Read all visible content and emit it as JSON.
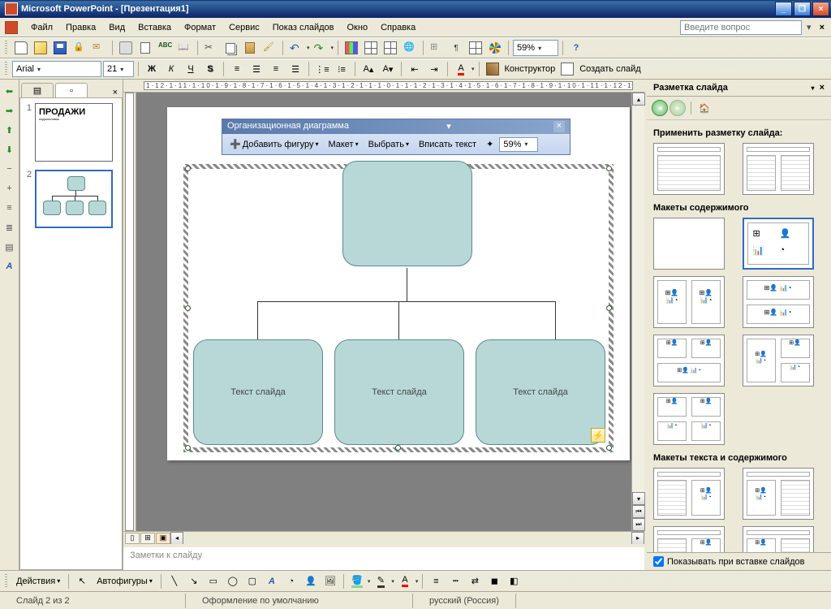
{
  "window": {
    "title": "Microsoft PowerPoint - [Презентация1]"
  },
  "menu": {
    "file": "Файл",
    "edit": "Правка",
    "view": "Вид",
    "insert": "Вставка",
    "format": "Формат",
    "service": "Сервис",
    "slideshow": "Показ слайдов",
    "window": "Окно",
    "help": "Справка",
    "question_placeholder": "Введите вопрос"
  },
  "toolbar1": {
    "zoom": "59%",
    "percent_org": "59%"
  },
  "toolbar2": {
    "font": "Arial",
    "size": "21",
    "constructor": "Конструктор",
    "new_slide": "Создать слайд"
  },
  "org_toolbar": {
    "title": "Организационная диаграмма",
    "add_shape": "Добавить фигуру",
    "layout": "Макет",
    "select": "Выбрать",
    "fit_text": "Вписать текст",
    "zoom": "59%"
  },
  "slide_text": {
    "box1": "Текст слайда",
    "box2": "Текст слайда",
    "box3": "Текст слайда"
  },
  "notes": {
    "placeholder": "Заметки к слайду"
  },
  "task_pane": {
    "title": "Разметка слайда",
    "apply_label": "Применить разметку слайда:",
    "section_content": "Макеты содержимого",
    "section_text_content": "Макеты текста и содержимого",
    "footer_checkbox": "Показывать при вставке слайдов"
  },
  "drawing": {
    "actions": "Действия",
    "autoshapes": "Автофигуры"
  },
  "status": {
    "slide_pos": "Слайд 2 из 2",
    "template": "Оформление по умолчанию",
    "language": "русский (Россия)"
  },
  "slides": {
    "num1": "1",
    "num2": "2"
  },
  "ruler_text": "1·12·1·11·1·10·1·9·1·8·1·7·1·6·1·5·1·4·1·3·1·2·1·1·1·0·1·1·1·2·1·3·1·4·1·5·1·6·1·7·1·8·1·9·1·10·1·11·1·12·1"
}
